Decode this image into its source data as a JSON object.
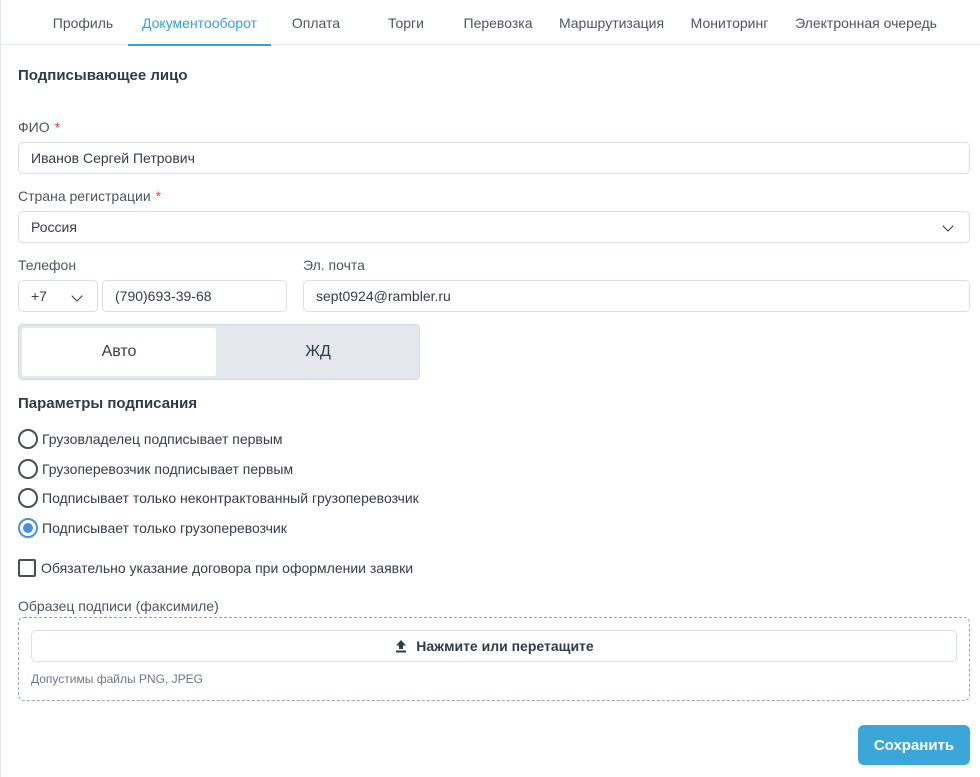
{
  "tabs": [
    {
      "label": "Профиль"
    },
    {
      "label": "Документооборот",
      "active": true
    },
    {
      "label": "Оплата"
    },
    {
      "label": "Торги"
    },
    {
      "label": "Перевозка"
    },
    {
      "label": "Маршрутизация"
    },
    {
      "label": "Мониторинг"
    },
    {
      "label": "Электронная очередь"
    }
  ],
  "signer": {
    "title": "Подписывающее лицо",
    "fio_label": "ФИО",
    "fio_value": "Иванов Сергей Петрович",
    "country_label": "Страна регистрации",
    "country_value": "Россия",
    "phone_label": "Телефон",
    "phone_code": "+7",
    "phone_value": "(790)693-39-68",
    "email_label": "Эл. почта",
    "email_value": "sept0924@rambler.ru",
    "required_mark": "*"
  },
  "transport": {
    "options": [
      "Авто",
      "ЖД"
    ],
    "selected": "Авто"
  },
  "signing": {
    "title": "Параметры подписания",
    "options": [
      {
        "label": "Грузовладелец подписывает первым",
        "checked": false
      },
      {
        "label": "Грузоперевозчик подписывает первым",
        "checked": false
      },
      {
        "label": "Подписывает только неконтрактованный грузоперевозчик",
        "checked": false
      },
      {
        "label": "Подписывает только грузоперевозчик",
        "checked": true
      }
    ],
    "contract_required_label": "Обязательно указание договора при оформлении заявки",
    "contract_required_checked": false
  },
  "facsimile": {
    "label": "Образец подписи (факсимиле)",
    "upload_label": "Нажмите или перетащите",
    "hint": "Допустимы файлы PNG, JPEG"
  },
  "actions": {
    "save_label": "Сохранить"
  },
  "colors": {
    "accent": "#2ea3dd",
    "save_button": "#3aa6da",
    "required": "#e0454b",
    "radio_checked": "#4a90e2"
  }
}
